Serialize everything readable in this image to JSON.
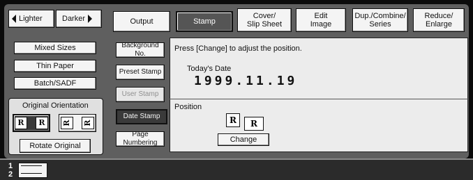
{
  "left": {
    "lighter": "Lighter",
    "darker": "Darker",
    "mixed_sizes": "Mixed Sizes",
    "thin_paper": "Thin Paper",
    "batch_sadf": "Batch/SADF",
    "orientation_label": "Original Orientation",
    "rotate_original": "Rotate Original",
    "icon_text": "R"
  },
  "tabs": {
    "output": "Output",
    "stamp": "Stamp",
    "cover_line1": "Cover/",
    "cover_line2": "Slip Sheet",
    "edit_line1": "Edit",
    "edit_line2": "Image",
    "dup_line1": "Dup./Combine/",
    "dup_line2": "Series",
    "reduce_line1": "Reduce/",
    "reduce_line2": "Enlarge"
  },
  "stamp_menu": {
    "background_no": "Background No.",
    "preset_stamp": "Preset Stamp",
    "user_stamp": "User Stamp",
    "date_stamp": "Date Stamp",
    "page_numbering": "Page Numbering"
  },
  "content": {
    "instruction": "Press [Change] to adjust the position.",
    "todays_date_label": "Today's Date",
    "date_value": "1999.11.19",
    "position_label": "Position",
    "change_button": "Change"
  },
  "status": {
    "indicator": "1",
    "indicator2": "2"
  }
}
